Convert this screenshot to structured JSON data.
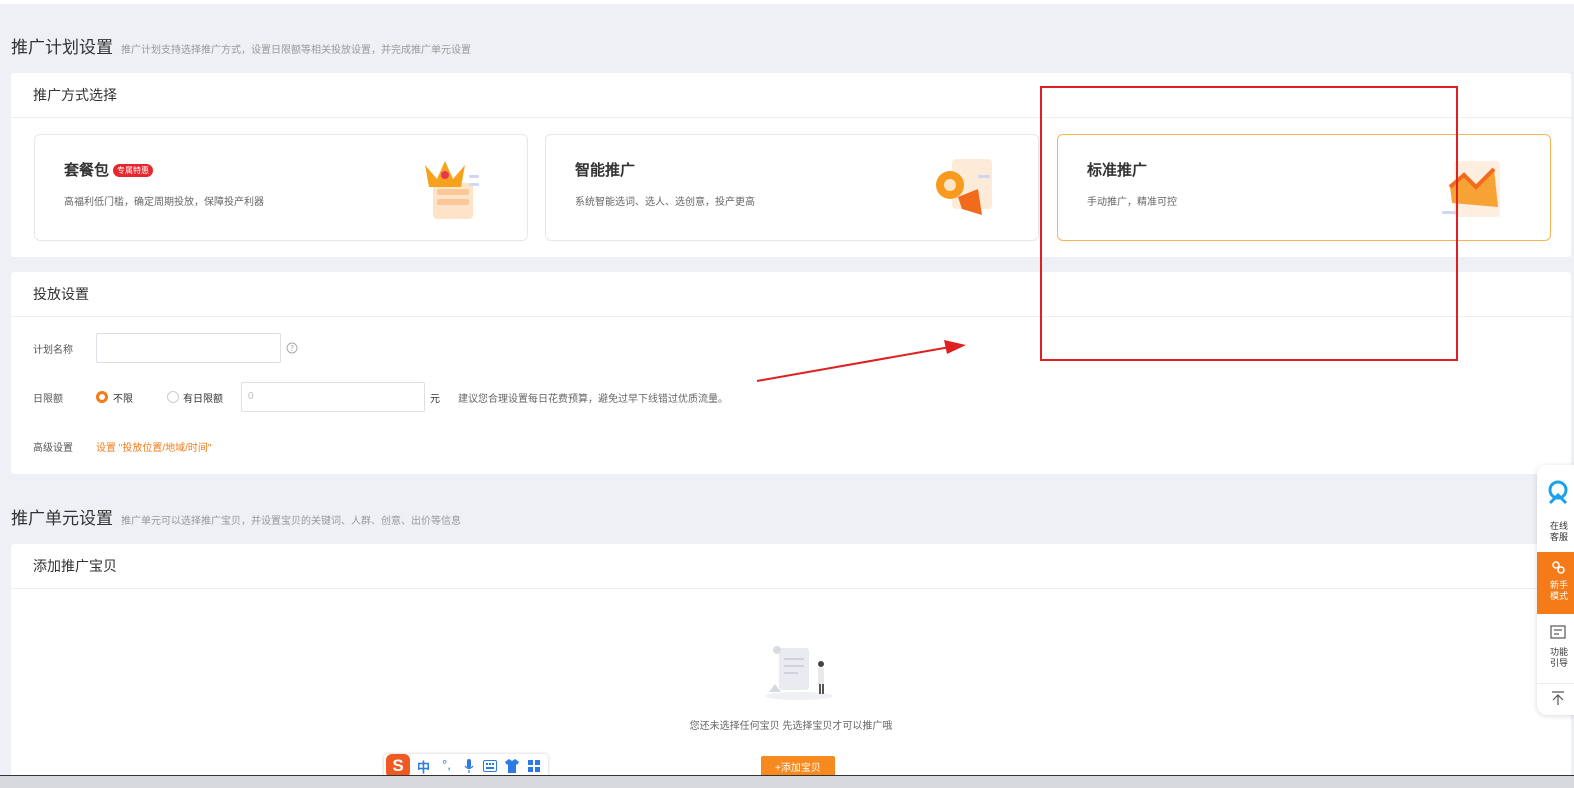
{
  "plan": {
    "title": "推广计划设置",
    "subtitle": "推广计划支持选择推广方式，设置日限额等相关投放设置，并完成推广单元设置"
  },
  "mode_select": {
    "heading": "推广方式选择",
    "options": [
      {
        "name": "套餐包",
        "badge": "专属特惠",
        "desc": "高福利低门槛，确定周期投放，保障投产利器"
      },
      {
        "name": "智能推广",
        "desc": "系统智能选词、选人、选创意，投产更高"
      },
      {
        "name": "标准推广",
        "desc": "手动推广，精准可控"
      }
    ],
    "selected": "标准推广"
  },
  "delivery": {
    "heading": "投放设置",
    "plan_name_label": "计划名称",
    "plan_name_value": "",
    "help_icon": "help-circle-icon",
    "daily_limit_label": "日限额",
    "radio_unlimited": "不限",
    "radio_limited": "有日限额",
    "limit_placeholder": "0",
    "unit": "元",
    "limit_hint": "建议您合理设置每日花费预算，避免过早下线错过优质流量。",
    "advanced_label": "高级设置",
    "advanced_link": "设置 \"投放位置/地域/时间\""
  },
  "unit": {
    "title": "推广单元设置",
    "subtitle": "推广单元可以选择推广宝贝，并设置宝贝的关键词、人群、创意、出价等信息"
  },
  "add_item": {
    "heading": "添加推广宝贝",
    "empty_text": "您还未选择任何宝贝 先选择宝贝才可以推广哦",
    "add_button": "+添加宝贝"
  },
  "sidebar": {
    "items": [
      {
        "icon": "customer-service-icon",
        "label1": "在线",
        "label2": "客服"
      },
      {
        "icon": "guide-icon",
        "label1": "新手",
        "label2": "模式"
      },
      {
        "icon": "feature-guide-icon",
        "label1": "功能",
        "label2": "引导"
      },
      {
        "icon": "back-to-top-icon"
      }
    ]
  },
  "ime_toolbar": {
    "logo": "S",
    "lang": "中",
    "punct": "°,",
    "icons": [
      "microphone-icon",
      "keyboard-icon",
      "skin-icon",
      "toolbox-icon"
    ]
  },
  "annotation": {
    "color": "#e02020"
  },
  "colors": {
    "accent": "#f57b19",
    "selected_border": "#f5b452",
    "badge": "#e7262d"
  }
}
